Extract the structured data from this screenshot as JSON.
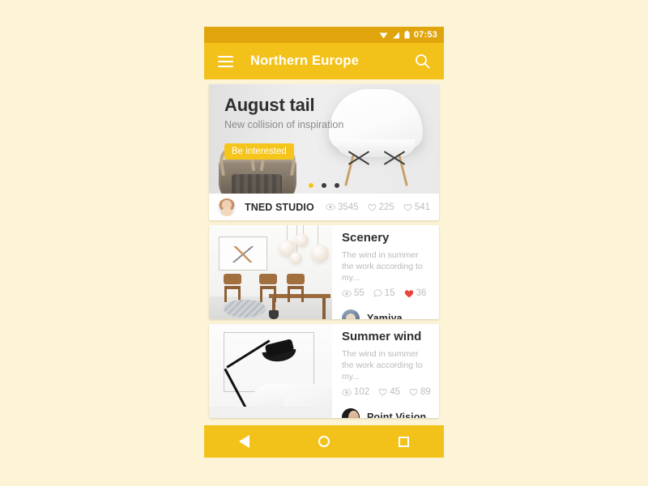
{
  "statusbar": {
    "time": "07:53",
    "icons": [
      "wifi-icon",
      "signal-icon",
      "battery-icon"
    ]
  },
  "appbar": {
    "menu_icon": "hamburger-menu-icon",
    "title": "Northern Europe",
    "search_icon": "search-icon"
  },
  "hero": {
    "title": "August tail",
    "subtitle": "New collision of inspiration",
    "cta_label": "Be interested",
    "carousel": {
      "count": 3,
      "active_index": 0,
      "active_color": "#F5C51C",
      "inactive_color": "#3C3C3C"
    },
    "author": {
      "name": "TNED STUDIO",
      "avatar": "avatar-tned-studio"
    },
    "stats": [
      {
        "icon": "eye-icon",
        "value": "3545"
      },
      {
        "icon": "heart-outline-icon",
        "value": "225"
      },
      {
        "icon": "heart-outline-icon",
        "value": "541"
      }
    ]
  },
  "cards": [
    {
      "title": "Scenery",
      "description": "The wind in summer the work according to my...",
      "thumbnail": "dining-room-photo",
      "stats": [
        {
          "icon": "eye-icon",
          "value": "55",
          "color": "#BDBDBD"
        },
        {
          "icon": "comment-outline-icon",
          "value": "15",
          "color": "#BDBDBD"
        },
        {
          "icon": "heart-filled-icon",
          "value": "36",
          "color": "#E8453C"
        }
      ],
      "author": {
        "name": "Yamiya",
        "avatar": "avatar-yamiya"
      }
    },
    {
      "title": "Summer wind",
      "description": "The wind in summer the work according to my...",
      "thumbnail": "desk-lamp-bedroom-photo",
      "stats": [
        {
          "icon": "eye-icon",
          "value": "102",
          "color": "#BDBDBD"
        },
        {
          "icon": "heart-outline-icon",
          "value": "45",
          "color": "#BDBDBD"
        },
        {
          "icon": "heart-outline-icon",
          "value": "89",
          "color": "#BDBDBD"
        }
      ],
      "author": {
        "name": "Point Vision",
        "avatar": "avatar-point-vision"
      }
    }
  ],
  "navbar": {
    "back": "back-triangle-icon",
    "home": "home-circle-icon",
    "recents": "recents-square-icon"
  },
  "theme": {
    "status_bar": "#E0A50C",
    "app_bar": "#F3C21A",
    "page_background": "#FDF4D7",
    "card_background": "#FFFFFF",
    "accent": "#F5C51C",
    "like_red": "#E8453C"
  }
}
